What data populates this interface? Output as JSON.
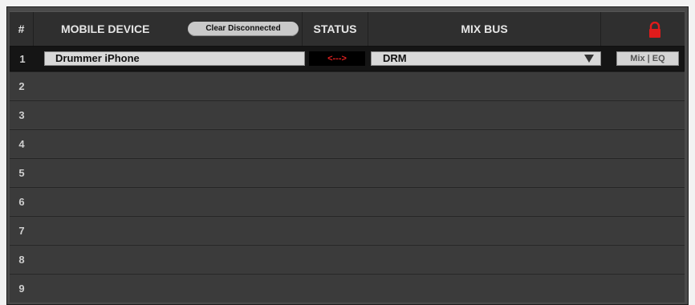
{
  "header": {
    "num": "#",
    "mobile_device": "MOBILE DEVICE",
    "clear_button": "Clear Disconnected",
    "status": "STATUS",
    "mix_bus": "MIX BUS",
    "lock_icon": "padlock-icon",
    "lock_color": "#e01b1b"
  },
  "rows": [
    {
      "num": "1",
      "device": "Drummer iPhone",
      "status": "<--->",
      "bus": "DRM",
      "mix_eq": "Mix | EQ"
    },
    {
      "num": "2"
    },
    {
      "num": "3"
    },
    {
      "num": "4"
    },
    {
      "num": "5"
    },
    {
      "num": "6"
    },
    {
      "num": "7"
    },
    {
      "num": "8"
    },
    {
      "num": "9"
    }
  ]
}
